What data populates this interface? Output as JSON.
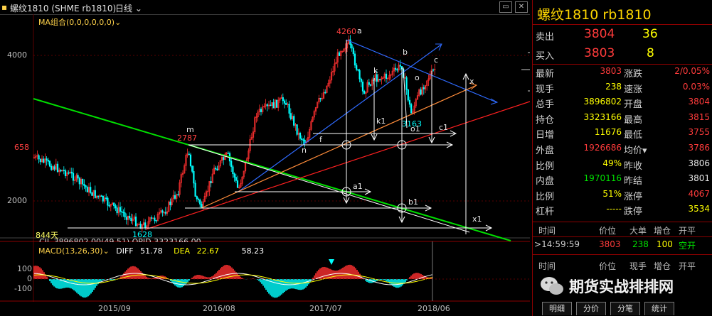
{
  "titlebar": {
    "symbol_title": "螺纹1810 (SHME rb1810)",
    "period": "日线",
    "minimize": "▭",
    "close": "✕"
  },
  "chart": {
    "ma_label": "MA组合(0,0,0,0,0,0)",
    "y_ticks": [
      "4000",
      "2000"
    ],
    "left_tags": {
      "p658": "658",
      "d844": "844天"
    },
    "price_labels": {
      "p4260": "4260",
      "p2787": "2787",
      "p3163": "3163",
      "p1628": "1628"
    },
    "letters": {
      "a": "a",
      "b": "b",
      "c": "c",
      "k": "k",
      "o": "o",
      "m": "m",
      "n": "n",
      "f": "f",
      "k1": "k1",
      "o1": "o1",
      "c1": "c1",
      "a1": "a1",
      "b1": "b1",
      "x": "x",
      "x1": "x1"
    },
    "overlay_row": "CJL 3896802.00(49.51) OPID 3323166.00",
    "macd": {
      "title": "MACD(13,26,30)",
      "diff_label": "DIFF",
      "diff_value": "51.78",
      "dea_label": "DEA",
      "dea_value": "22.67",
      "macd_value": "58.23",
      "ticks": [
        "100",
        "0",
        "-100"
      ]
    },
    "x_labels": [
      "2015/09",
      "2016/08",
      "2017/07",
      "2018/06"
    ],
    "colors": {
      "up": "#ff3030",
      "down": "#00ffff",
      "green_line": "#00e000",
      "blue_line": "#2f6bff",
      "white_line": "#ffffff",
      "red_line": "#ff2020",
      "orange_line": "#ff8c3a",
      "yellow": "#ffff00"
    }
  },
  "panel": {
    "title": "螺纹1810 rb1810",
    "sell": {
      "label": "卖出",
      "price": "3804",
      "qty": "36"
    },
    "buy": {
      "label": "买入",
      "price": "3803",
      "qty": "8"
    },
    "stats": [
      {
        "l1": "最新",
        "v1": "3803",
        "c1": "red",
        "l2": "涨跌",
        "v2": "2/0.05%",
        "c2": "red"
      },
      {
        "l1": "现手",
        "v1": "238",
        "c1": "yel",
        "l2": "速涨",
        "v2": "0.03%",
        "c2": "red"
      },
      {
        "l1": "总手",
        "v1": "3896802",
        "c1": "yel",
        "l2": "开盘",
        "v2": "3804",
        "c2": "red"
      },
      {
        "l1": "持仓",
        "v1": "3323166",
        "c1": "yel",
        "l2": "最高",
        "v2": "3815",
        "c2": "red"
      },
      {
        "l1": "日增",
        "v1": "11676",
        "c1": "yel",
        "l2": "最低",
        "v2": "3755",
        "c2": "red"
      },
      {
        "l1": "外盘",
        "v1": "1926686",
        "c1": "red",
        "l2": "均价▾",
        "v2": "3786",
        "c2": "red"
      },
      {
        "l1": "比例",
        "v1": "49%",
        "c1": "yel",
        "l2": "昨收",
        "v2": "3806",
        "c2": "wht"
      },
      {
        "l1": "内盘",
        "v1": "1970116",
        "c1": "grn",
        "l2": "昨结",
        "v2": "3801",
        "c2": "wht"
      },
      {
        "l1": "比例",
        "v1": "51%",
        "c1": "yel",
        "l2": "涨停",
        "v2": "4067",
        "c2": "red"
      },
      {
        "l1": "杠杆",
        "v1": "-----",
        "c1": "yel",
        "l2": "跌停",
        "v2": "3534",
        "c2": "yel"
      }
    ],
    "tick_header": [
      "时间",
      "价位",
      "大单",
      "增仓",
      "开平"
    ],
    "tick_row": {
      "time": "14:59:59",
      "price": "3803",
      "vol": "238",
      "oi": "100",
      "type": "空开"
    },
    "tick_header2": [
      "时间",
      "价位",
      "现手",
      "增仓",
      "开平"
    ],
    "tabs": [
      "明细",
      "分价",
      "分笔",
      "统计"
    ],
    "watermark": "期货实战排排网"
  }
}
